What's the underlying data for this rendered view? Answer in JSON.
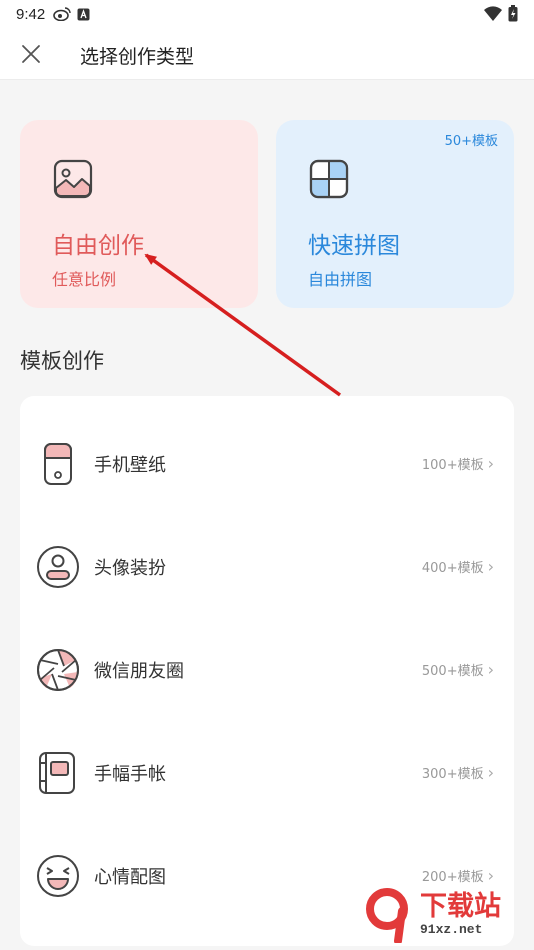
{
  "status_bar": {
    "time": "9:42"
  },
  "header": {
    "title": "选择创作类型"
  },
  "cards": {
    "free": {
      "title": "自由创作",
      "subtitle": "任意比例"
    },
    "quick": {
      "title": "快速拼图",
      "subtitle": "自由拼图",
      "badge": "50+模板"
    }
  },
  "section": {
    "title": "模板创作"
  },
  "templates": [
    {
      "label": "手机壁纸",
      "count": "100+模板",
      "icon": "phone-icon"
    },
    {
      "label": "头像装扮",
      "count": "400+模板",
      "icon": "avatar-icon"
    },
    {
      "label": "微信朋友圈",
      "count": "500+模板",
      "icon": "aperture-icon"
    },
    {
      "label": "手幅手帐",
      "count": "300+模板",
      "icon": "notebook-icon"
    },
    {
      "label": "心情配图",
      "count": "200+模板",
      "icon": "smiley-icon"
    }
  ],
  "watermark": {
    "big": "下载站",
    "small": "91xz.net"
  },
  "colors": {
    "free_accent": "#e05a5a",
    "quick_accent": "#2b88db",
    "pink_fill": "#f3b8b8"
  }
}
